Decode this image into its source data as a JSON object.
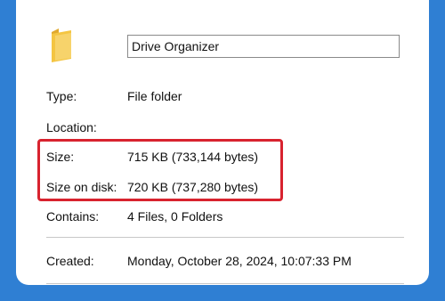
{
  "folder": {
    "icon": "folder-icon",
    "name": "Drive Organizer"
  },
  "properties": {
    "type_label": "Type:",
    "type_value": "File folder",
    "location_label": "Location:",
    "location_value": "",
    "size_label": "Size:",
    "size_value": "715 KB (733,144 bytes)",
    "size_on_disk_label": "Size on disk:",
    "size_on_disk_value": "720 KB (737,280 bytes)",
    "contains_label": "Contains:",
    "contains_value": "4 Files, 0 Folders",
    "created_label": "Created:",
    "created_value": "Monday, October 28, 2024, 10:07:33 PM"
  },
  "colors": {
    "background": "#2f7fd3",
    "highlight": "#d8232f",
    "folder": "#f4c542"
  }
}
